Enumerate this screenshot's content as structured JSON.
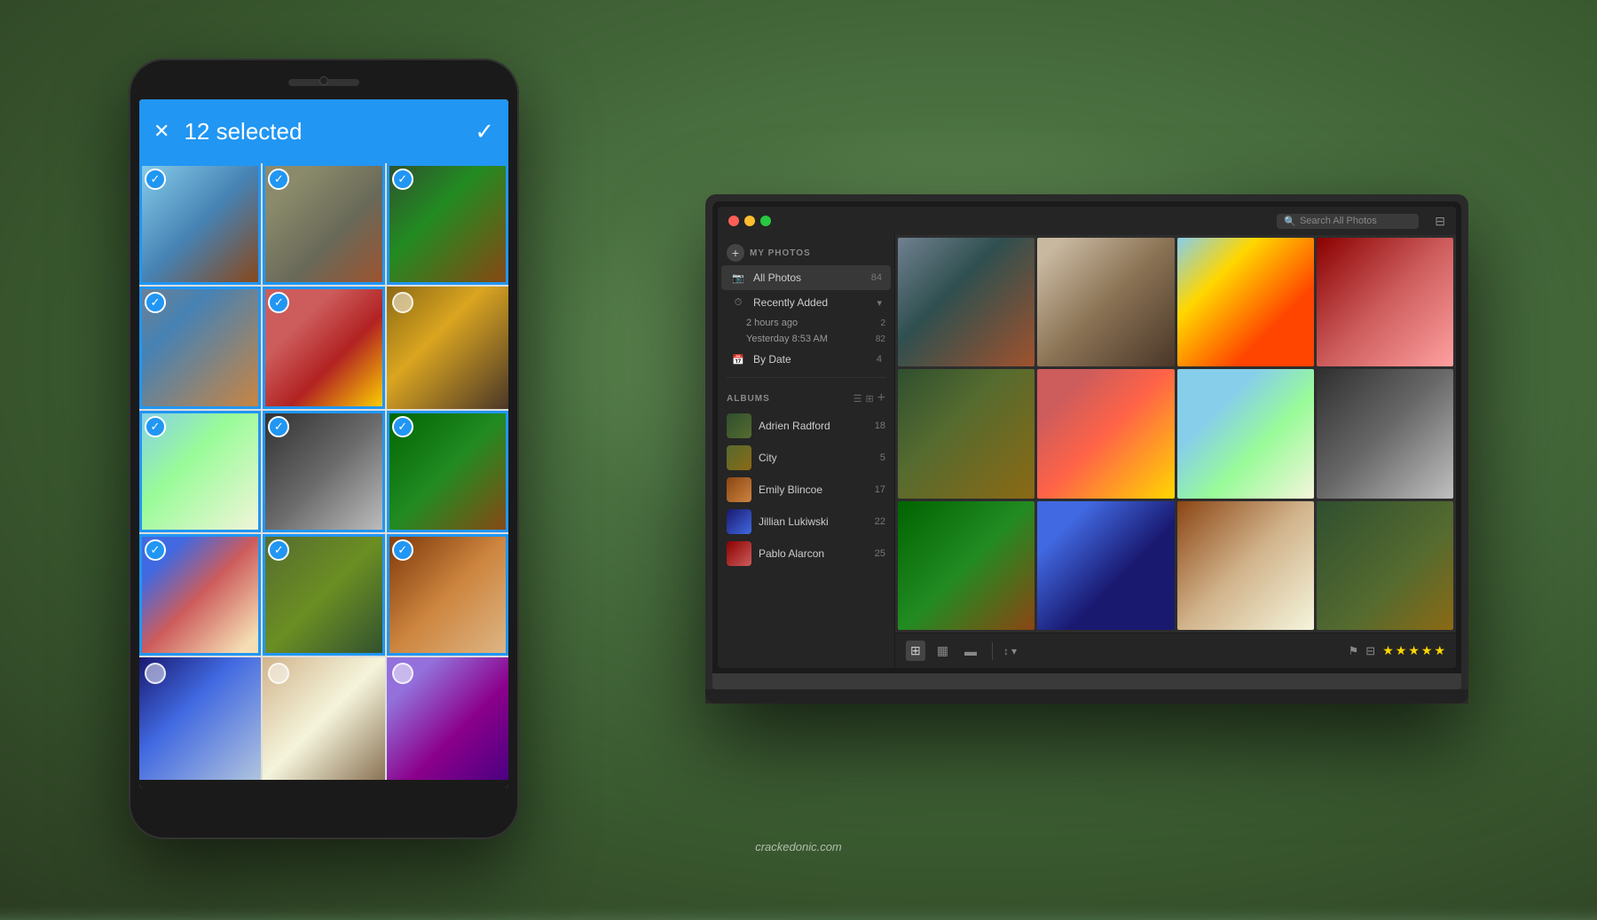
{
  "background": {
    "gradient": "bokeh forest background"
  },
  "phone": {
    "topbar": {
      "close_icon": "✕",
      "selected_label": "12 selected",
      "check_icon": "✓"
    },
    "grid_photos": [
      {
        "id": 1,
        "class": "p1",
        "selected": true
      },
      {
        "id": 2,
        "class": "p2",
        "selected": true
      },
      {
        "id": 3,
        "class": "p3",
        "selected": true
      },
      {
        "id": 4,
        "class": "p4",
        "selected": true
      },
      {
        "id": 5,
        "class": "p5",
        "selected": true
      },
      {
        "id": 6,
        "class": "p6",
        "selected": false
      },
      {
        "id": 7,
        "class": "p7",
        "selected": true
      },
      {
        "id": 8,
        "class": "p8",
        "selected": true
      },
      {
        "id": 9,
        "class": "p9",
        "selected": true
      },
      {
        "id": 10,
        "class": "p10",
        "selected": true
      },
      {
        "id": 11,
        "class": "p11",
        "selected": true
      },
      {
        "id": 12,
        "class": "p12",
        "selected": true
      },
      {
        "id": 13,
        "class": "p13",
        "selected": false
      },
      {
        "id": 14,
        "class": "p14",
        "selected": false
      },
      {
        "id": 15,
        "class": "p15",
        "selected": false
      }
    ],
    "nav": {
      "back_icon": "◁",
      "home_icon": "⌂",
      "recent_icon": "▭"
    }
  },
  "laptop": {
    "titlebar": {
      "search_placeholder": "Search All Photos",
      "filter_icon": "▼"
    },
    "sidebar": {
      "my_photos_label": "MY PHOTOS",
      "add_icon": "+",
      "items": [
        {
          "label": "All Photos",
          "count": 84,
          "icon": "📷"
        },
        {
          "label": "Recently Added",
          "count": null,
          "icon": "⏱",
          "expanded": true
        },
        {
          "sub_items": [
            {
              "label": "2 hours ago",
              "count": 2
            },
            {
              "label": "Yesterday 8:53 AM",
              "count": 82
            }
          ]
        },
        {
          "label": "By Date",
          "count": 4,
          "icon": "📅"
        }
      ],
      "albums_label": "ALBUMS",
      "albums_view_list": "☰",
      "albums_view_grid": "⊞",
      "albums_add": "+",
      "albums": [
        {
          "name": "Adrien Radford",
          "count": 18,
          "color": "at1"
        },
        {
          "name": "City",
          "count": 5,
          "color": "at2"
        },
        {
          "name": "Emily Blincoe",
          "count": 17,
          "color": "at3"
        },
        {
          "name": "Jillian Lukiwski",
          "count": 22,
          "color": "at4"
        },
        {
          "name": "Pablo Alarcon",
          "count": 25,
          "color": "at5"
        }
      ]
    },
    "photo_grid": [
      {
        "id": 1,
        "class": "mp1"
      },
      {
        "id": 2,
        "class": "mp2"
      },
      {
        "id": 3,
        "class": "mp3"
      },
      {
        "id": 4,
        "class": "mp4"
      },
      {
        "id": 5,
        "class": "mp5"
      },
      {
        "id": 6,
        "class": "mp6"
      },
      {
        "id": 7,
        "class": "mp7"
      },
      {
        "id": 8,
        "class": "mp8"
      },
      {
        "id": 9,
        "class": "mp9"
      },
      {
        "id": 10,
        "class": "mp10"
      },
      {
        "id": 11,
        "class": "mp11"
      },
      {
        "id": 12,
        "class": "mp12"
      }
    ],
    "toolbar": {
      "view_icons": [
        "⊞",
        "▦",
        "▬"
      ],
      "sort_label": "↕",
      "flag_icon": "⚑",
      "stars": [
        "★",
        "★",
        "★",
        "★",
        "★"
      ]
    }
  },
  "watermark": {
    "text": "crackedonic.com"
  }
}
